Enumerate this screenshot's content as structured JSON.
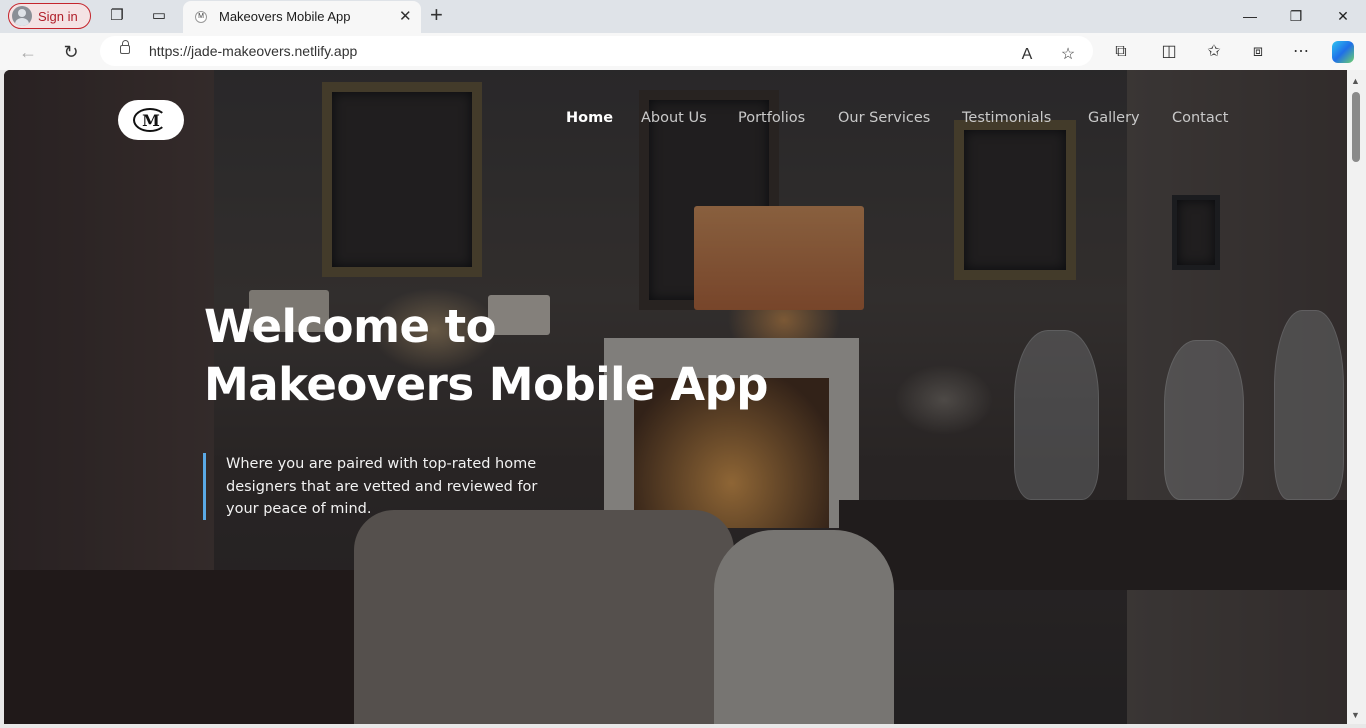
{
  "browser": {
    "signin_label": "Sign in",
    "tab_title": "Makeovers Mobile App",
    "url": "https://jade-makeovers.netlify.app",
    "icons": [
      "workspaces-icon",
      "vertical-tabs-icon",
      "back-icon",
      "refresh-icon",
      "lock-icon",
      "read-aloud-icon",
      "favorite-icon",
      "extensions-icon",
      "split-screen-icon",
      "favorites-icon",
      "collections-icon",
      "more-icon",
      "copilot-icon"
    ]
  },
  "site": {
    "logo_text": "M",
    "nav": [
      "Home",
      "About Us",
      "Portfolios",
      "Our Services",
      "Testimonials",
      "Gallery",
      "Contact"
    ],
    "active_nav": "Home",
    "hero": {
      "title_line1": "Welcome to",
      "title_line2": "Makeovers Mobile App",
      "subtitle": "Where you are paired with top-rated home designers that are vetted and reviewed for your peace of mind."
    }
  },
  "colors": {
    "accent_bar": "#5aa9e6",
    "signin_border": "#c4252c"
  }
}
